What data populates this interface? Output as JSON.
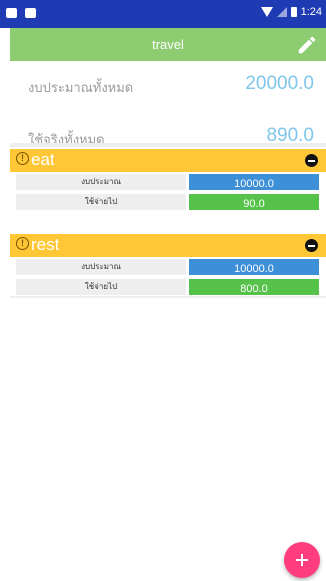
{
  "status_bar": {
    "time": "1:24"
  },
  "app_bar": {
    "title": "travel",
    "edit_icon": "pencil-icon"
  },
  "summary": {
    "total_budget_label": "งบประมาณทั้งหมด",
    "total_budget_value": "20000.0",
    "total_spent_label": "ใช้จริงทั้งหมด",
    "total_spent_value": "890.0"
  },
  "categories": [
    {
      "name": "eat",
      "budget_label": "งบประมาณ",
      "budget_value": "10000.0",
      "spent_label": "ใช้จ่ายไป",
      "spent_value": "90.0"
    },
    {
      "name": "rest",
      "budget_label": "งบประมาณ",
      "budget_value": "10000.0",
      "spent_label": "ใช้จ่ายไป",
      "spent_value": "800.0"
    }
  ],
  "colors": {
    "status_bar": "#1f3bb3",
    "app_bar": "#8dcc70",
    "category_header": "#ffc735",
    "budget_bar": "#3d8fd8",
    "spent_bar": "#56c24a",
    "amount_text": "#7fc6ea",
    "fab": "#ff3d7f"
  },
  "fab": {
    "icon": "plus-icon"
  }
}
